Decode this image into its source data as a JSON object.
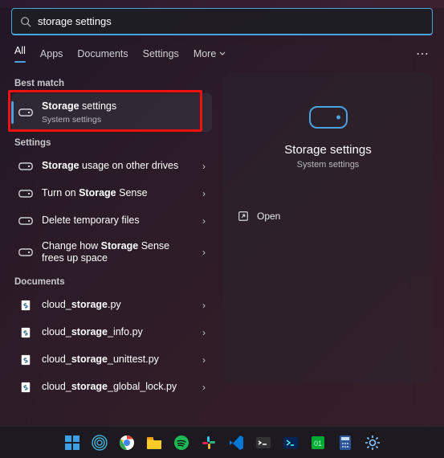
{
  "search": {
    "query": "storage settings"
  },
  "tabs": {
    "items": [
      "All",
      "Apps",
      "Documents",
      "Settings",
      "More"
    ],
    "active": 0
  },
  "sections": {
    "best_match": "Best match",
    "settings": "Settings",
    "documents": "Documents"
  },
  "best": {
    "title_prefix_bold": "Storage",
    "title_rest": " settings",
    "subtitle": "System settings"
  },
  "settings_list": [
    {
      "bold": "Storage",
      "rest": " usage on other drives"
    },
    {
      "pre": "Turn on ",
      "bold": "Storage",
      "post": " Sense"
    },
    {
      "pre": "Delete temporary files",
      "bold": "",
      "post": ""
    },
    {
      "pre": "Change how ",
      "bold": "Storage",
      "post": " Sense frees up space"
    }
  ],
  "documents_list": [
    {
      "pre": "cloud_",
      "bold": "storage",
      "post": ".py"
    },
    {
      "pre": "cloud_",
      "bold": "storage",
      "post": "_info.py"
    },
    {
      "pre": "cloud_",
      "bold": "storage",
      "post": "_unittest.py"
    },
    {
      "pre": "cloud_",
      "bold": "storage",
      "post": "_global_lock.py"
    }
  ],
  "preview": {
    "title": "Storage settings",
    "subtitle": "System settings",
    "open_label": "Open"
  },
  "taskbar": {
    "items": [
      "start",
      "broadcast",
      "chrome",
      "files",
      "spotify",
      "slack",
      "vscode",
      "terminal",
      "powershell",
      "matrix",
      "calc",
      "settings"
    ]
  }
}
